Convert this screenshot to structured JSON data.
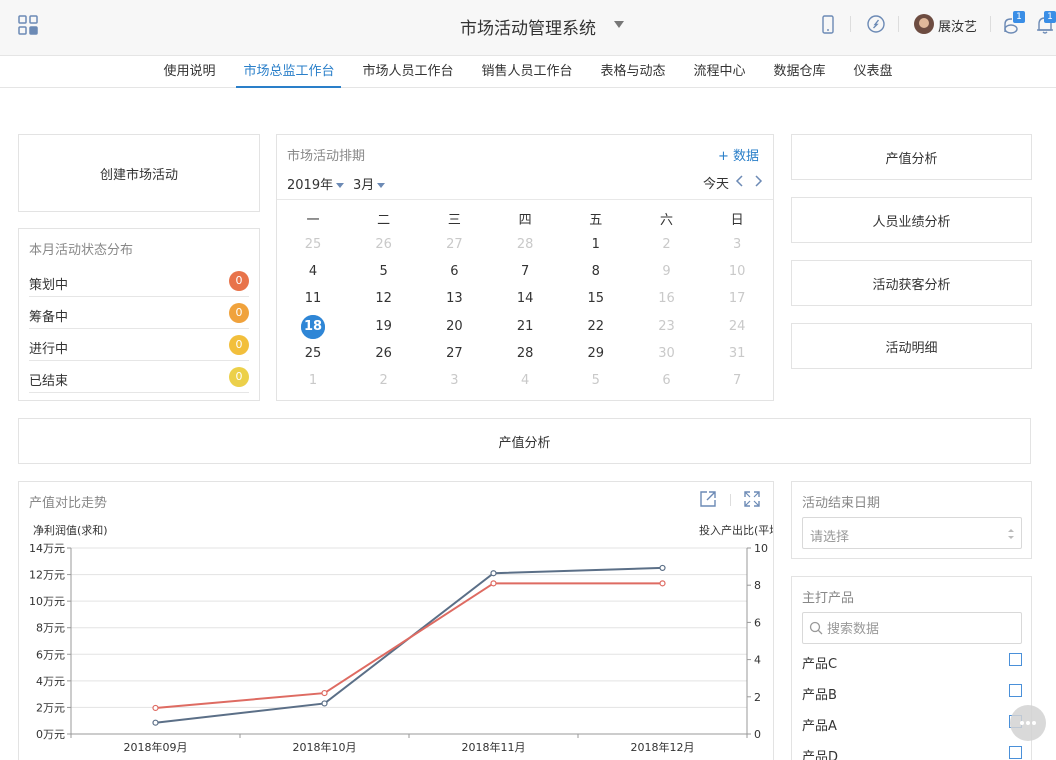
{
  "header": {
    "title": "市场活动管理系统",
    "user_name": "展汝艺",
    "msg_badge": "1",
    "bell_badge": "1"
  },
  "nav": {
    "tabs": [
      {
        "label": "使用说明"
      },
      {
        "label": "市场总监工作台"
      },
      {
        "label": "市场人员工作台"
      },
      {
        "label": "销售人员工作台"
      },
      {
        "label": "表格与动态"
      },
      {
        "label": "流程中心"
      },
      {
        "label": "数据仓库"
      },
      {
        "label": "仪表盘"
      }
    ],
    "active_index": 1
  },
  "left": {
    "create_label": "创建市场活动",
    "status_title": "本月活动状态分布",
    "status_items": [
      {
        "label": "策划中",
        "count": "0",
        "color": "#e8734a"
      },
      {
        "label": "筹备中",
        "count": "0",
        "color": "#f0a23c"
      },
      {
        "label": "进行中",
        "count": "0",
        "color": "#f2bf3c"
      },
      {
        "label": "已结束",
        "count": "0",
        "color": "#ecd04a"
      }
    ]
  },
  "calendar": {
    "title": "市场活动排期",
    "add_label": "+ 数据",
    "year_label": "2019年",
    "month_label": "3月",
    "today_label": "今天",
    "weekdays": [
      "一",
      "二",
      "三",
      "四",
      "五",
      "六",
      "日"
    ],
    "weeks": [
      [
        {
          "d": "25",
          "muted": true
        },
        {
          "d": "26",
          "muted": true
        },
        {
          "d": "27",
          "muted": true
        },
        {
          "d": "28",
          "muted": true
        },
        {
          "d": "1"
        },
        {
          "d": "2",
          "muted": true
        },
        {
          "d": "3",
          "muted": true
        }
      ],
      [
        {
          "d": "4"
        },
        {
          "d": "5"
        },
        {
          "d": "6"
        },
        {
          "d": "7"
        },
        {
          "d": "8"
        },
        {
          "d": "9",
          "muted": true
        },
        {
          "d": "10",
          "muted": true
        }
      ],
      [
        {
          "d": "11"
        },
        {
          "d": "12"
        },
        {
          "d": "13"
        },
        {
          "d": "14"
        },
        {
          "d": "15"
        },
        {
          "d": "16",
          "muted": true
        },
        {
          "d": "17",
          "muted": true
        }
      ],
      [
        {
          "d": "18",
          "today": true
        },
        {
          "d": "19"
        },
        {
          "d": "20"
        },
        {
          "d": "21"
        },
        {
          "d": "22"
        },
        {
          "d": "23",
          "muted": true
        },
        {
          "d": "24",
          "muted": true
        }
      ],
      [
        {
          "d": "25"
        },
        {
          "d": "26"
        },
        {
          "d": "27"
        },
        {
          "d": "28"
        },
        {
          "d": "29"
        },
        {
          "d": "30",
          "muted": true
        },
        {
          "d": "31",
          "muted": true
        }
      ],
      [
        {
          "d": "1",
          "muted": true
        },
        {
          "d": "2",
          "muted": true
        },
        {
          "d": "3",
          "muted": true
        },
        {
          "d": "4",
          "muted": true
        },
        {
          "d": "5",
          "muted": true
        },
        {
          "d": "6",
          "muted": true
        },
        {
          "d": "7",
          "muted": true
        }
      ]
    ]
  },
  "right_links": [
    "产值分析",
    "人员业绩分析",
    "活动获客分析",
    "活动明细"
  ],
  "section_label": "产值分析",
  "chart_data": {
    "type": "line",
    "title": "产值对比走势",
    "left_axis_title": "净利润值(求和)",
    "right_axis_title": "投入产出比(平均",
    "categories": [
      "2018年09月",
      "2018年10月",
      "2018年11月",
      "2018年12月"
    ],
    "left_ticks": [
      "0万元",
      "2万元",
      "4万元",
      "6万元",
      "8万元",
      "10万元",
      "12万元",
      "14万元"
    ],
    "right_ticks": [
      "0",
      "2",
      "4",
      "6",
      "8",
      "10"
    ],
    "ylim_left": [
      0,
      140000
    ],
    "ylim_right": [
      0,
      10
    ],
    "grid": true,
    "series": [
      {
        "axis": "left",
        "color": "#5b6f87",
        "values": [
          8500,
          23000,
          121000,
          125000
        ]
      },
      {
        "axis": "right",
        "color": "#de6b62",
        "values": [
          1.4,
          2.2,
          8.1,
          8.1
        ]
      }
    ]
  },
  "filters": {
    "end_date_title": "活动结束日期",
    "end_date_placeholder": "请选择",
    "product_title": "主打产品",
    "search_placeholder": "搜索数据",
    "products": [
      {
        "label": "产品C"
      },
      {
        "label": "产品B"
      },
      {
        "label": "产品A"
      },
      {
        "label": "产品D"
      }
    ]
  }
}
